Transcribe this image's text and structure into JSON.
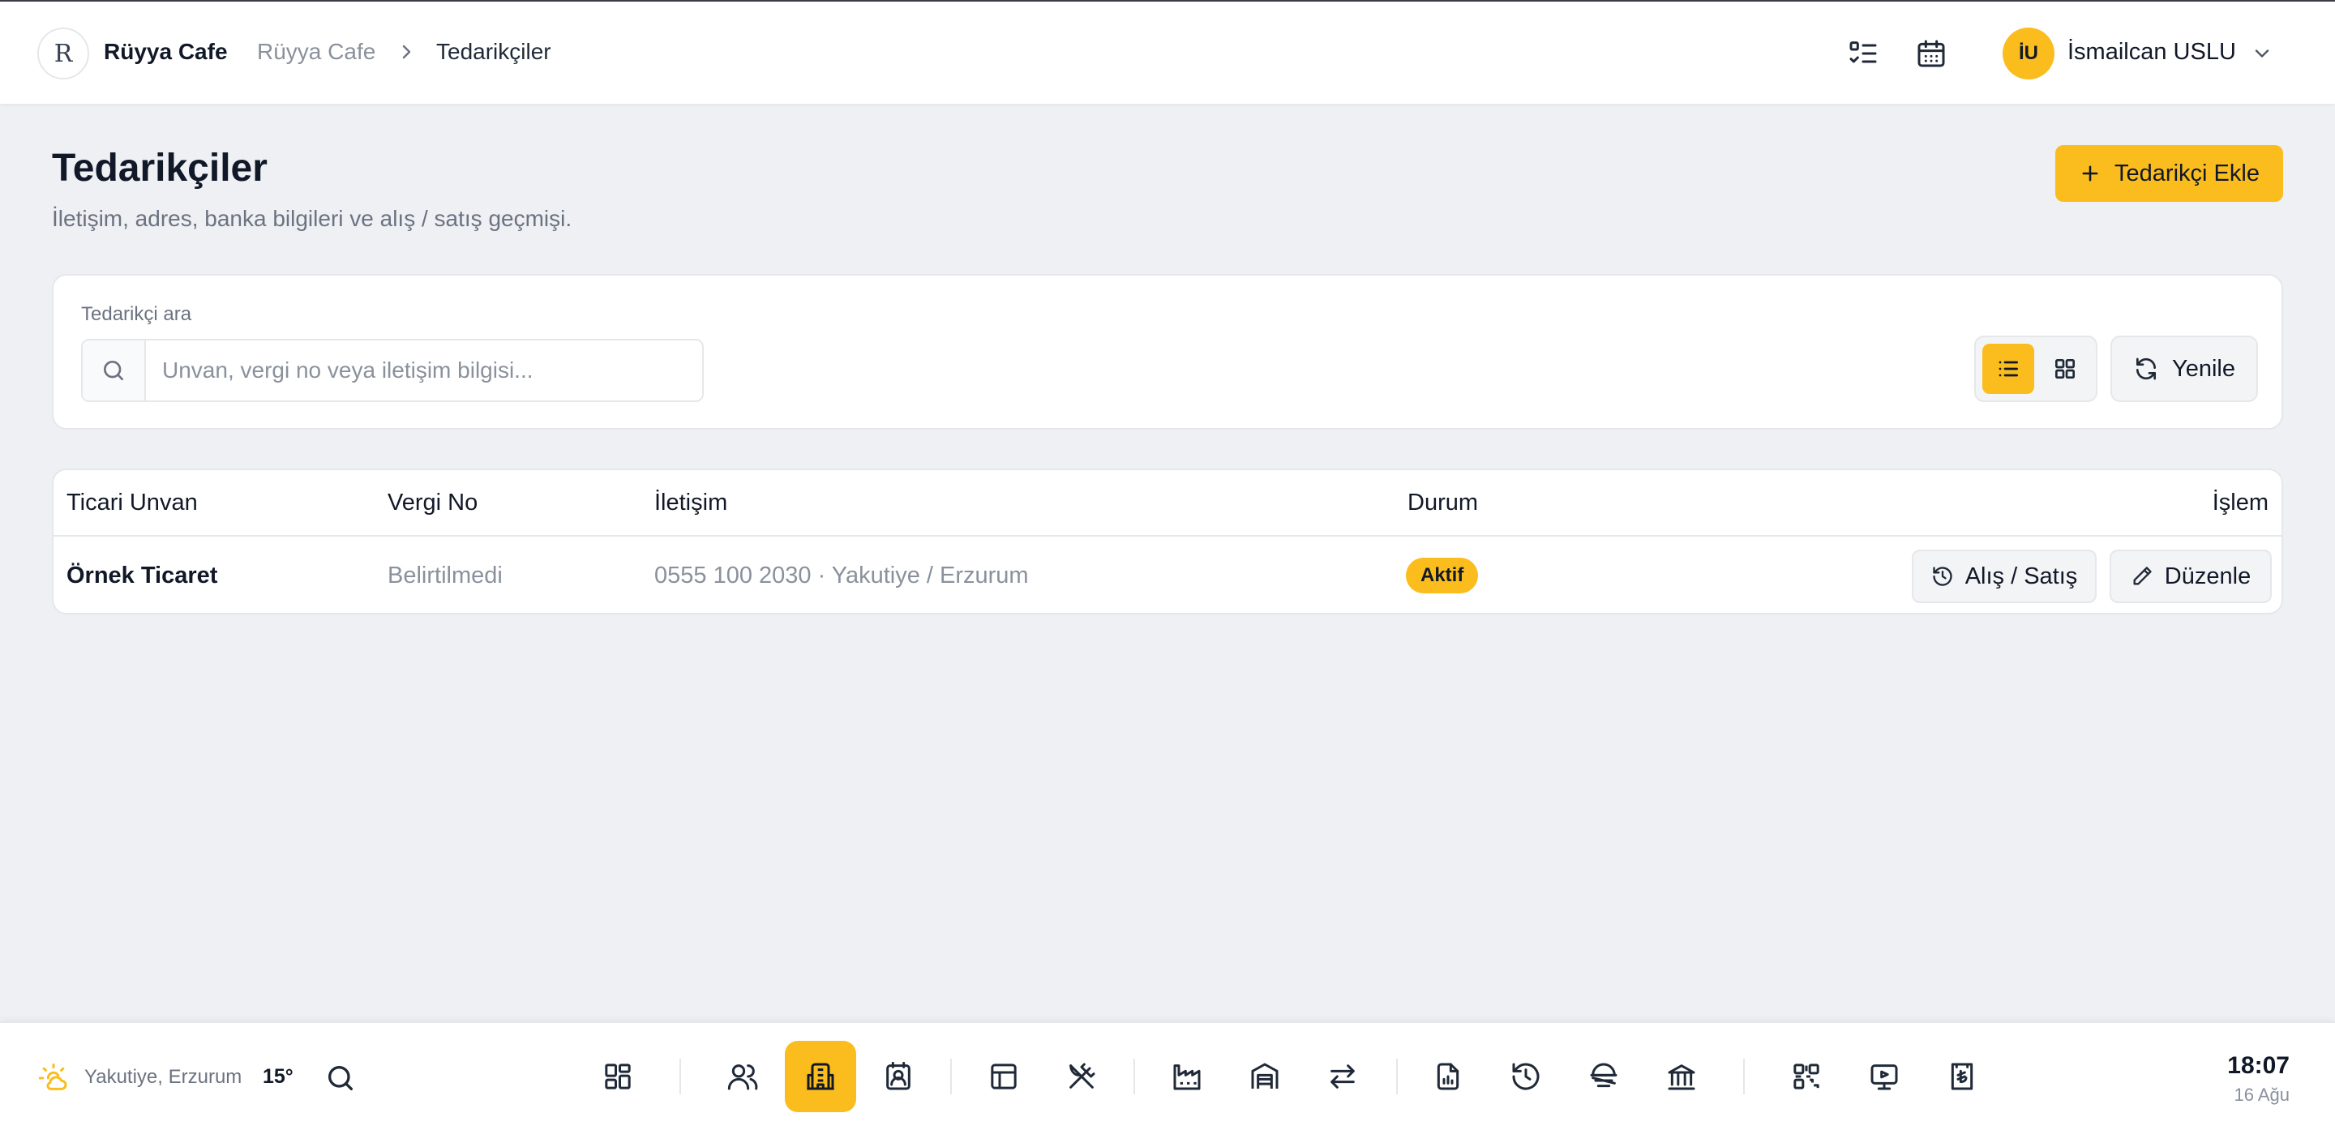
{
  "header": {
    "brand": "Rüyya Cafe",
    "logo_text": "R",
    "breadcrumb": [
      "Rüyya Cafe",
      "Tedarikçiler"
    ],
    "user": {
      "initials": "İU",
      "name": "İsmailcan USLU"
    }
  },
  "page": {
    "title": "Tedarikçiler",
    "subtitle": "İletişim, adres, banka bilgileri ve alış / satış geçmişi.",
    "add_button": "Tedarikçi Ekle"
  },
  "search": {
    "label": "Tedarikçi ara",
    "placeholder": "Unvan, vergi no veya iletişim bilgisi...",
    "value": "",
    "refresh_label": "Yenile",
    "view_mode": "list"
  },
  "table": {
    "columns": [
      "Ticari Unvan",
      "Vergi No",
      "İletişim",
      "Durum",
      "İşlem"
    ],
    "rows": [
      {
        "name": "Örnek Ticaret",
        "tax_no": "Belirtilmedi",
        "contact": "0555 100 2030 · Yakutiye / Erzurum",
        "status": "Aktif",
        "actions": [
          "Alış / Satış",
          "Düzenle"
        ]
      }
    ]
  },
  "dock": {
    "weather": {
      "location": "Yakutiye, Erzurum",
      "temp": "15°",
      "icon": "partly-sunny-icon"
    },
    "items": [
      {
        "icon": "dashboard-icon"
      },
      {
        "icon": "users-icon"
      },
      {
        "icon": "building-icon",
        "active": true
      },
      {
        "icon": "contact-card-icon"
      },
      {
        "icon": "layout-icon"
      },
      {
        "icon": "utensils-icon"
      },
      {
        "icon": "factory-icon"
      },
      {
        "icon": "warehouse-icon"
      },
      {
        "icon": "transfer-icon"
      },
      {
        "icon": "report-icon"
      },
      {
        "icon": "history-icon"
      },
      {
        "icon": "coins-icon"
      },
      {
        "icon": "bank-icon"
      },
      {
        "icon": "qr-code-icon"
      },
      {
        "icon": "presentation-icon"
      },
      {
        "icon": "lira-receipt-icon"
      }
    ],
    "clock": {
      "time": "18:07",
      "date": "16 Ağu"
    }
  },
  "colors": {
    "accent": "#fbbd1e",
    "background": "#eef0f4",
    "text": "#111827",
    "muted": "#8a919c"
  }
}
